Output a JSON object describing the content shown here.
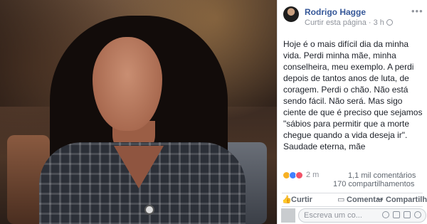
{
  "post": {
    "author": "Rodrigo Hagge",
    "meta": {
      "follow_link": "Curtir esta página",
      "separator": " · ",
      "time": "3 h"
    },
    "more_icon": "more-options-icon",
    "text": "Hoje é o mais difícil dia da minha vida. Perdi minha mãe, minha conselheira, meu exemplo. A perdi depois de tantos anos de luta, de coragem. Perdi o chão. Não está sendo fácil. Não será. Mas sigo ciente de que é preciso que sejamos \"sábios para permitir que a morte chegue quando a vida deseja ir\".\nSaudade eterna, mãe",
    "reactions": {
      "icons": [
        "sad-reaction-icon",
        "like-reaction-icon",
        "love-reaction-icon"
      ],
      "count": "2 m"
    },
    "comments_count": "1,1 mil comentários",
    "shares_count": "170 compartilhamentos",
    "actions": {
      "like": "Curtir",
      "comment": "Comentar",
      "share": "Compartilhar"
    },
    "comment_input": {
      "placeholder": "Escreva um co..."
    }
  },
  "colors": {
    "author": "#365899",
    "muted": "#90949c",
    "text": "#1d2129"
  }
}
